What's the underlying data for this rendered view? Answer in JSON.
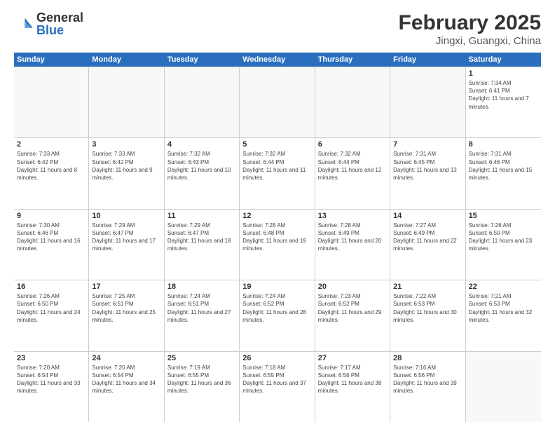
{
  "header": {
    "logo_general": "General",
    "logo_blue": "Blue",
    "title": "February 2025",
    "subtitle": "Jingxi, Guangxi, China"
  },
  "weekdays": [
    "Sunday",
    "Monday",
    "Tuesday",
    "Wednesday",
    "Thursday",
    "Friday",
    "Saturday"
  ],
  "weeks": [
    [
      {
        "day": "",
        "info": ""
      },
      {
        "day": "",
        "info": ""
      },
      {
        "day": "",
        "info": ""
      },
      {
        "day": "",
        "info": ""
      },
      {
        "day": "",
        "info": ""
      },
      {
        "day": "",
        "info": ""
      },
      {
        "day": "1",
        "info": "Sunrise: 7:34 AM\nSunset: 6:41 PM\nDaylight: 11 hours and 7 minutes."
      }
    ],
    [
      {
        "day": "2",
        "info": "Sunrise: 7:33 AM\nSunset: 6:42 PM\nDaylight: 11 hours and 8 minutes."
      },
      {
        "day": "3",
        "info": "Sunrise: 7:33 AM\nSunset: 6:42 PM\nDaylight: 11 hours and 9 minutes."
      },
      {
        "day": "4",
        "info": "Sunrise: 7:32 AM\nSunset: 6:43 PM\nDaylight: 11 hours and 10 minutes."
      },
      {
        "day": "5",
        "info": "Sunrise: 7:32 AM\nSunset: 6:44 PM\nDaylight: 11 hours and 11 minutes."
      },
      {
        "day": "6",
        "info": "Sunrise: 7:32 AM\nSunset: 6:44 PM\nDaylight: 11 hours and 12 minutes."
      },
      {
        "day": "7",
        "info": "Sunrise: 7:31 AM\nSunset: 6:45 PM\nDaylight: 11 hours and 13 minutes."
      },
      {
        "day": "8",
        "info": "Sunrise: 7:31 AM\nSunset: 6:46 PM\nDaylight: 11 hours and 15 minutes."
      }
    ],
    [
      {
        "day": "9",
        "info": "Sunrise: 7:30 AM\nSunset: 6:46 PM\nDaylight: 11 hours and 16 minutes."
      },
      {
        "day": "10",
        "info": "Sunrise: 7:29 AM\nSunset: 6:47 PM\nDaylight: 11 hours and 17 minutes."
      },
      {
        "day": "11",
        "info": "Sunrise: 7:29 AM\nSunset: 6:47 PM\nDaylight: 11 hours and 18 minutes."
      },
      {
        "day": "12",
        "info": "Sunrise: 7:28 AM\nSunset: 6:48 PM\nDaylight: 11 hours and 19 minutes."
      },
      {
        "day": "13",
        "info": "Sunrise: 7:28 AM\nSunset: 6:49 PM\nDaylight: 11 hours and 20 minutes."
      },
      {
        "day": "14",
        "info": "Sunrise: 7:27 AM\nSunset: 6:49 PM\nDaylight: 11 hours and 22 minutes."
      },
      {
        "day": "15",
        "info": "Sunrise: 7:26 AM\nSunset: 6:50 PM\nDaylight: 11 hours and 23 minutes."
      }
    ],
    [
      {
        "day": "16",
        "info": "Sunrise: 7:26 AM\nSunset: 6:50 PM\nDaylight: 11 hours and 24 minutes."
      },
      {
        "day": "17",
        "info": "Sunrise: 7:25 AM\nSunset: 6:51 PM\nDaylight: 11 hours and 25 minutes."
      },
      {
        "day": "18",
        "info": "Sunrise: 7:24 AM\nSunset: 6:51 PM\nDaylight: 11 hours and 27 minutes."
      },
      {
        "day": "19",
        "info": "Sunrise: 7:24 AM\nSunset: 6:52 PM\nDaylight: 11 hours and 28 minutes."
      },
      {
        "day": "20",
        "info": "Sunrise: 7:23 AM\nSunset: 6:52 PM\nDaylight: 11 hours and 29 minutes."
      },
      {
        "day": "21",
        "info": "Sunrise: 7:22 AM\nSunset: 6:53 PM\nDaylight: 11 hours and 30 minutes."
      },
      {
        "day": "22",
        "info": "Sunrise: 7:21 AM\nSunset: 6:53 PM\nDaylight: 11 hours and 32 minutes."
      }
    ],
    [
      {
        "day": "23",
        "info": "Sunrise: 7:20 AM\nSunset: 6:54 PM\nDaylight: 11 hours and 33 minutes."
      },
      {
        "day": "24",
        "info": "Sunrise: 7:20 AM\nSunset: 6:54 PM\nDaylight: 11 hours and 34 minutes."
      },
      {
        "day": "25",
        "info": "Sunrise: 7:19 AM\nSunset: 6:55 PM\nDaylight: 11 hours and 36 minutes."
      },
      {
        "day": "26",
        "info": "Sunrise: 7:18 AM\nSunset: 6:55 PM\nDaylight: 11 hours and 37 minutes."
      },
      {
        "day": "27",
        "info": "Sunrise: 7:17 AM\nSunset: 6:56 PM\nDaylight: 11 hours and 38 minutes."
      },
      {
        "day": "28",
        "info": "Sunrise: 7:16 AM\nSunset: 6:56 PM\nDaylight: 11 hours and 39 minutes."
      },
      {
        "day": "",
        "info": ""
      }
    ]
  ]
}
